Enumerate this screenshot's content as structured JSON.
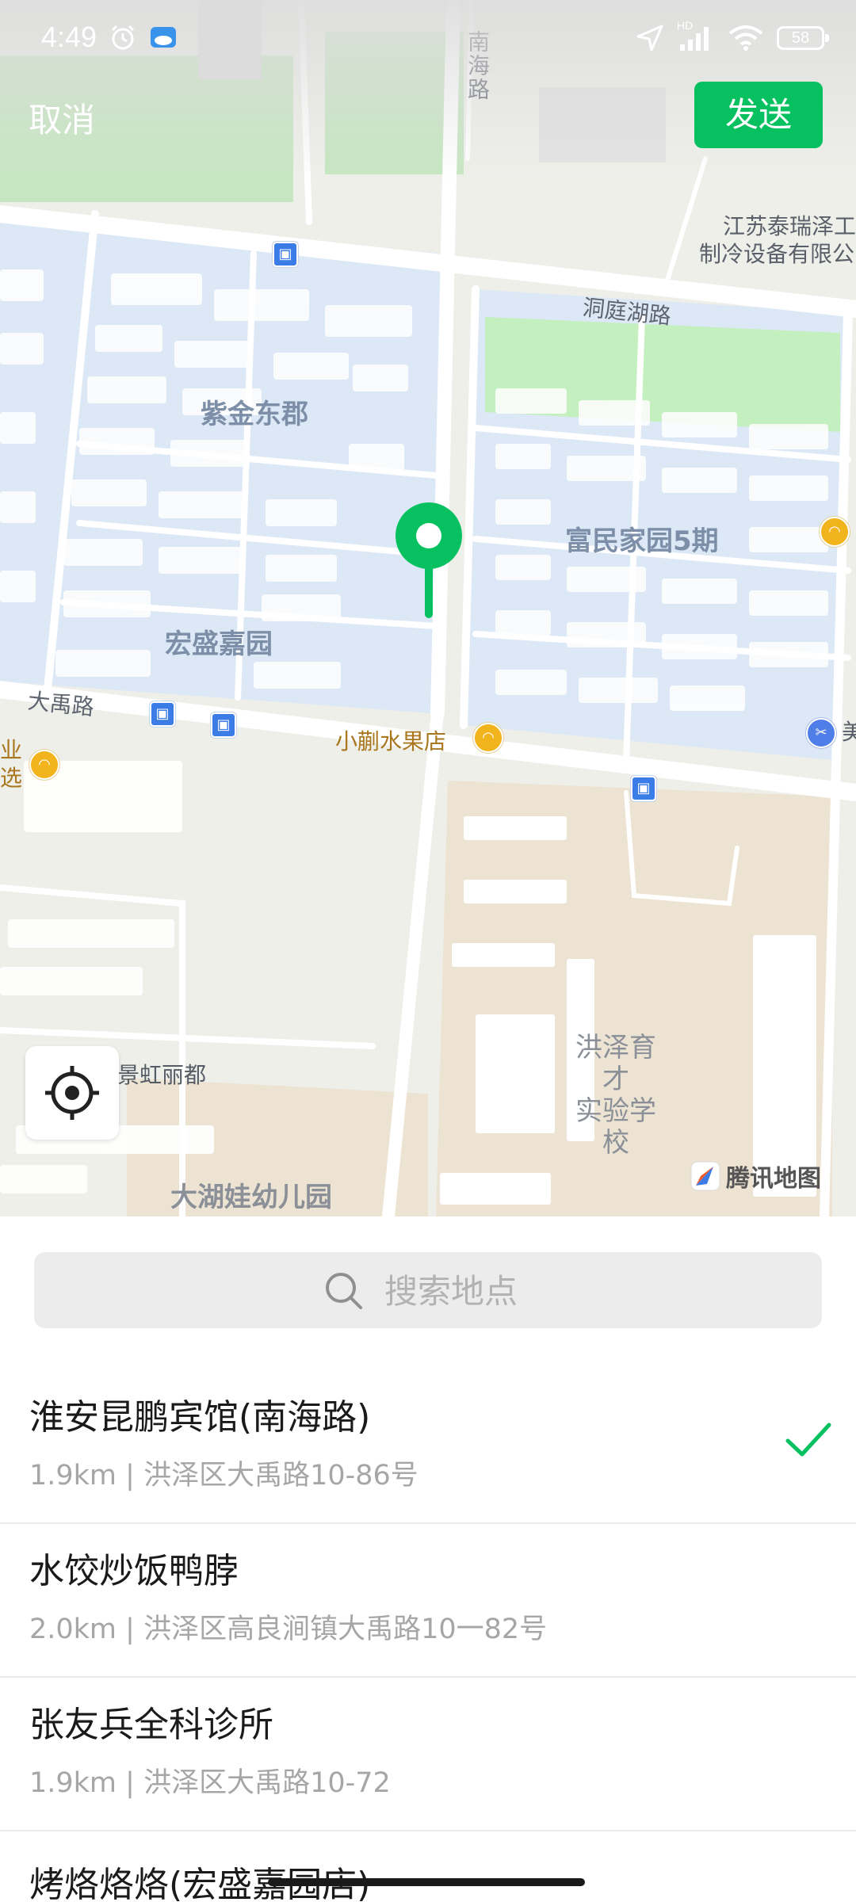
{
  "status_bar": {
    "time": "4:49",
    "network_badge": "HD",
    "battery": "58",
    "icons": [
      "alarm-icon",
      "weather-icon",
      "location-arrow-icon",
      "signal-icon",
      "wifi-icon",
      "battery-icon"
    ]
  },
  "header": {
    "cancel_label": "取消",
    "send_label": "发送",
    "send_color": "#07c160"
  },
  "map": {
    "labels": {
      "road_nanhai": "南海路",
      "company_line1": "江苏泰瑞泽工",
      "company_line2": "制冷设备有限公",
      "road_dongting": "洞庭湖路",
      "zijin": "紫金东郡",
      "fumin": "富民家园5期",
      "hongsheng": "宏盛嘉园",
      "road_dayu": "大禹路",
      "fruit_shop": "小蒯水果店",
      "left_edge_line1": "业",
      "left_edge_line2": "选",
      "school_line1": "洪泽育才",
      "school_line2": "实验学校",
      "jinghong": "景虹丽都",
      "kindergarten": "大湖娃幼儿园",
      "right_edge": "美"
    },
    "watermark": "腾讯地图",
    "pin_color": "#07c160"
  },
  "search": {
    "placeholder": "搜索地点"
  },
  "results": [
    {
      "name": "淮安昆鹏宾馆(南海路)",
      "address": "1.9km | 洪泽区大禹路10-86号",
      "selected": true
    },
    {
      "name": "水饺炒饭鸭脖",
      "address": "2.0km | 洪泽区高良涧镇大禹路10一82号",
      "selected": false
    },
    {
      "name": "张友兵全科诊所",
      "address": "1.9km | 洪泽区大禹路10-72",
      "selected": false
    },
    {
      "name": "烤烙烙烙(宏盛嘉园店)",
      "address": "",
      "selected": false
    }
  ]
}
